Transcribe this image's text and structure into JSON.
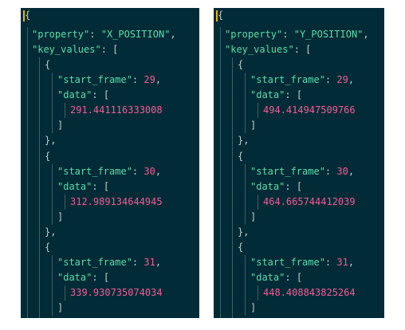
{
  "panels": [
    {
      "property": "X_POSITION",
      "key_values": [
        {
          "start_frame": "29",
          "data": "291.441116333008"
        },
        {
          "start_frame": "30",
          "data": "312.989134644945"
        },
        {
          "start_frame": "31",
          "data": "339.930735074034"
        }
      ]
    },
    {
      "property": "Y_POSITION",
      "key_values": [
        {
          "start_frame": "29",
          "data": "494.414947509766"
        },
        {
          "start_frame": "30",
          "data": "464.665744412039"
        },
        {
          "start_frame": "31",
          "data": "448.408843825264"
        }
      ]
    }
  ],
  "syntax": {
    "open_brace": "{",
    "close_brace": "}",
    "close_brace_comma": "},",
    "open_bracket": "[",
    "close_bracket": "]",
    "colon": ": ",
    "comma": ",",
    "key_property": "\"property\"",
    "key_key_values": "\"key_values\"",
    "key_start_frame": "\"start_frame\"",
    "key_data": "\"data\""
  },
  "colors": {
    "background": "#012b36",
    "key": "#5ddcab",
    "number": "#f25c9a",
    "punctuation": "#c2cdd0",
    "cursor": "#e6b800"
  }
}
